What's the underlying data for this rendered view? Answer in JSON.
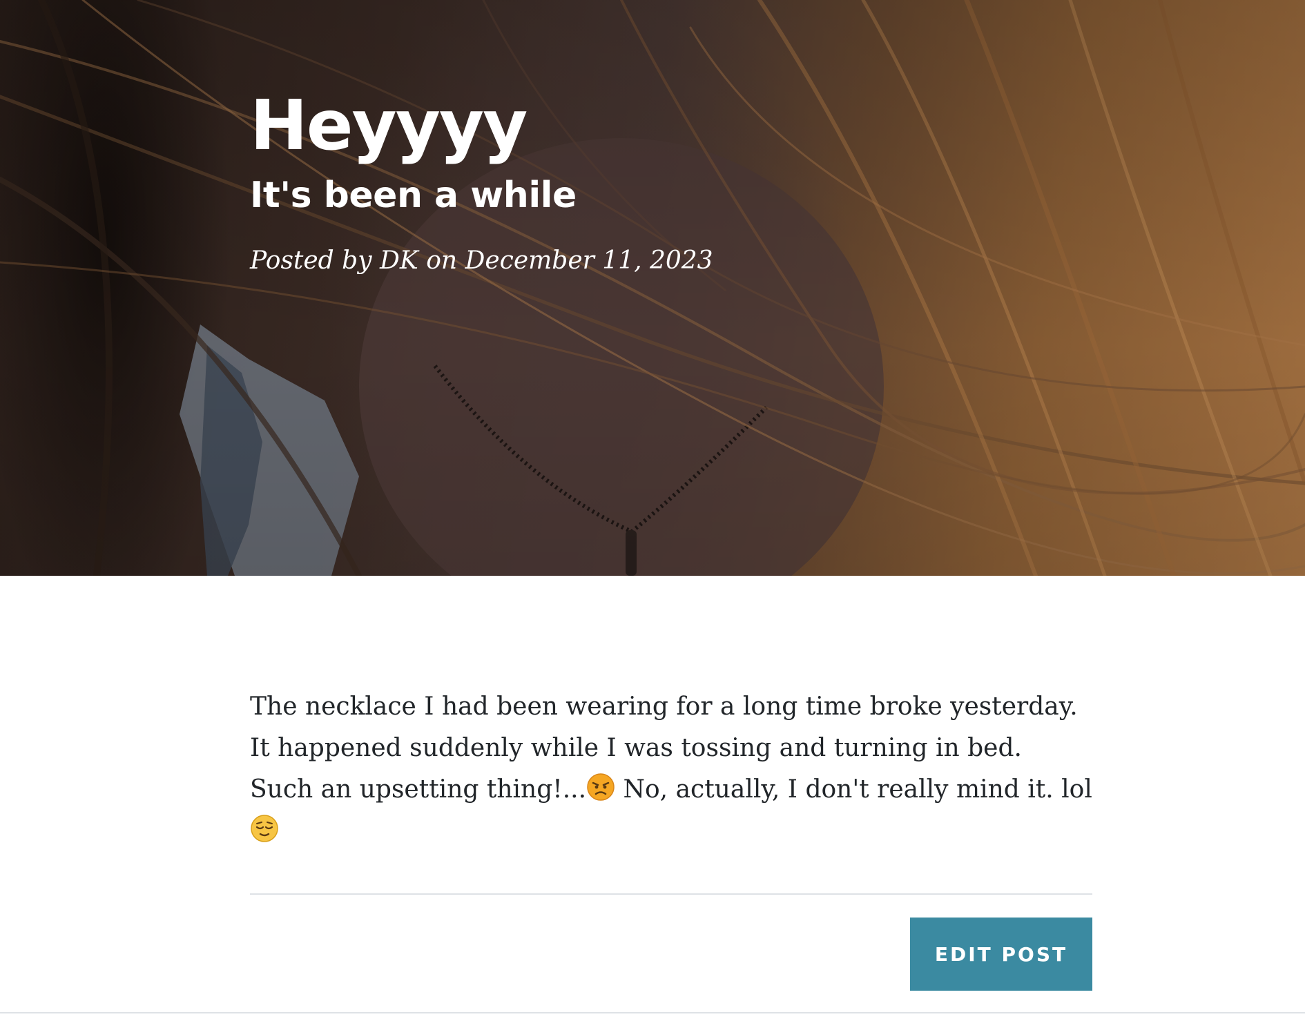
{
  "post": {
    "title": "Heyyyy",
    "subtitle": "It's been a while",
    "meta": "Posted by DK on December 11, 2023",
    "body_lines": [
      "The necklace I had been wearing for a long time broke yesterday.",
      "It happened suddenly while I was tossing and turning in bed.",
      "Such an upsetting thing!...",
      " No, actually, I don't really mind it. lol"
    ],
    "emojis": [
      "angry-face-emoji",
      "relieved-face-emoji"
    ]
  },
  "actions": {
    "edit_label": "Edit Post"
  },
  "colors": {
    "button_bg": "#3b8aa1",
    "body_text": "#212529",
    "divider": "#dee2e6"
  }
}
